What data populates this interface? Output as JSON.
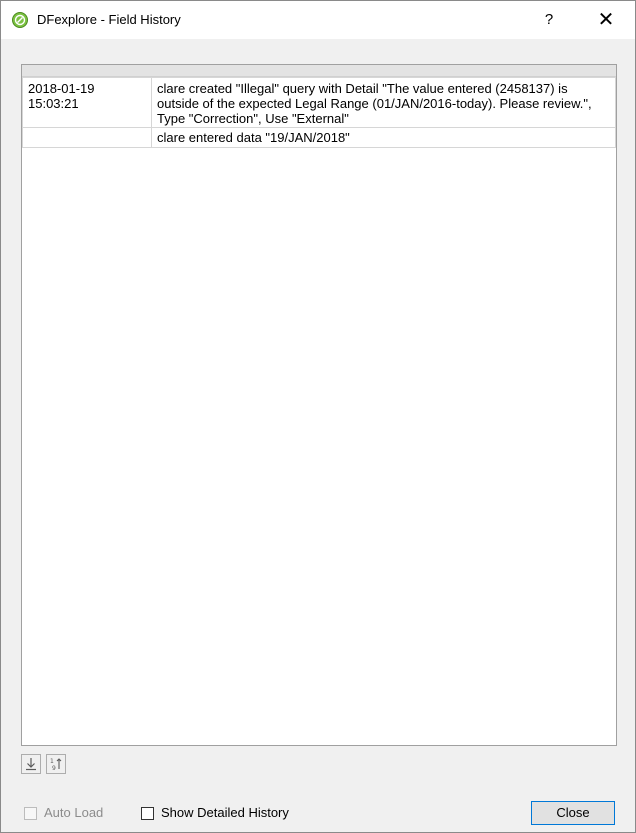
{
  "window": {
    "title": "DFexplore - Field History",
    "help_label": "?",
    "close_glyph": "✕",
    "icon": "dfexplore-app-icon"
  },
  "history": {
    "rows": [
      {
        "date": "2018-01-19",
        "time": "15:03:21",
        "description": "clare created \"Illegal\" query with Detail \"The value entered (2458137) is outside of the expected Legal Range (01/JAN/2016-today). Please review.\", Type \"Correction\", Use \"External\""
      },
      {
        "date": "",
        "time": "",
        "description": "clare entered data \"19/JAN/2018\""
      }
    ]
  },
  "toolbar": {
    "export_icon": "download-icon",
    "sort_icon": "sort-numeric-icon"
  },
  "footer": {
    "auto_load_label": "Auto Load",
    "auto_load_checked": false,
    "auto_load_enabled": false,
    "show_detailed_label": "Show Detailed History",
    "show_detailed_checked": false,
    "close_label": "Close"
  },
  "colors": {
    "accent": "#0078d7",
    "icon_green": "#7cc242"
  }
}
